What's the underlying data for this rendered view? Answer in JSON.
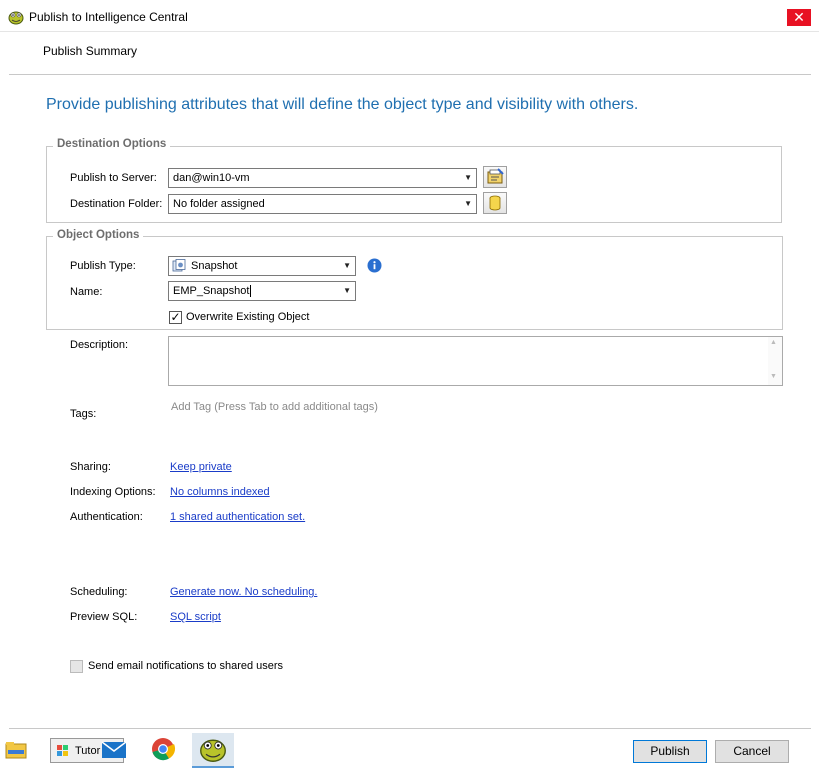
{
  "window": {
    "title": "Publish to Intelligence Central",
    "close_glyph": "✕"
  },
  "summary": {
    "label": "Publish Summary"
  },
  "headline": "Provide publishing attributes that will define the object type and visibility with others.",
  "destination": {
    "title": "Destination Options",
    "server_label": "Publish to Server:",
    "server_value": "dan@win10-vm",
    "folder_label": "Destination Folder:",
    "folder_value": "No folder assigned"
  },
  "object": {
    "title": "Object Options",
    "type_label": "Publish Type:",
    "type_value": "Snapshot",
    "name_label": "Name:",
    "name_value": "EMP_Snapshot",
    "overwrite_label": "Overwrite Existing Object",
    "overwrite_checked": true
  },
  "description": {
    "label": "Description:",
    "value": ""
  },
  "tags": {
    "label": "Tags:",
    "placeholder": "Add Tag (Press Tab to add additional tags)"
  },
  "sharing": {
    "label": "Sharing:",
    "link": "Keep private"
  },
  "indexing": {
    "label": "Indexing Options:",
    "link": "No columns indexed"
  },
  "authentication": {
    "label": "Authentication:",
    "link": "1 shared authentication set."
  },
  "scheduling": {
    "label": "Scheduling:",
    "link": "Generate now. No scheduling."
  },
  "preview_sql": {
    "label": "Preview SQL:",
    "link": "SQL script"
  },
  "email": {
    "label": "Send email notifications to shared users",
    "checked": false
  },
  "buttons": {
    "publish": "Publish",
    "cancel": "Cancel"
  },
  "taskbar": {
    "tutor_label": "Tutor"
  },
  "colors": {
    "accent": "#1f6fb0",
    "link": "#1a3cc8",
    "close": "#e81123"
  },
  "icons": [
    "app-frog-icon",
    "server-properties-icon",
    "database-folder-icon",
    "snapshot-icon",
    "info-icon",
    "dropdown-arrow-icon",
    "checkmark-icon",
    "file-explorer-icon",
    "mail-icon",
    "chrome-icon"
  ]
}
